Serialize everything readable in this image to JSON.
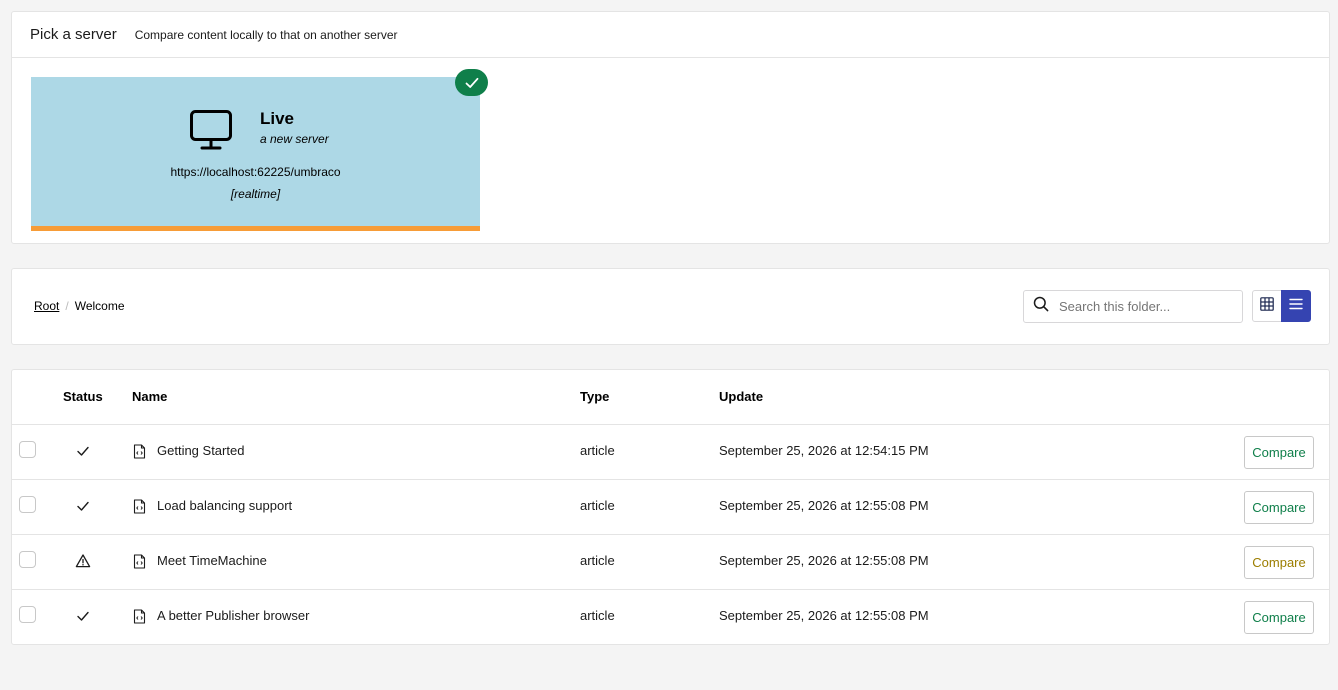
{
  "server_picker": {
    "title": "Pick a server",
    "subtitle": "Compare content locally to that on another server",
    "server": {
      "name": "Live",
      "description": "a new server",
      "url": "https://localhost:62225/umbraco",
      "mode": "[realtime]",
      "selected": true,
      "icon": "monitor-icon",
      "card_color": "#add8e6",
      "accent_color": "#f79c37"
    }
  },
  "breadcrumb": {
    "root_label": "Root",
    "separator": "/",
    "current_label": "Welcome"
  },
  "search": {
    "placeholder": "Search this folder...",
    "value": ""
  },
  "view_toggle": {
    "options": [
      "grid",
      "list"
    ],
    "selected": "list"
  },
  "table": {
    "headers": {
      "status": "Status",
      "name": "Name",
      "type": "Type",
      "update": "Update"
    },
    "rows": [
      {
        "status": "ok",
        "name": "Getting Started",
        "type": "article",
        "update": "September 25, 2026 at 12:54:15 PM",
        "action": "Compare"
      },
      {
        "status": "ok",
        "name": "Load balancing support",
        "type": "article",
        "update": "September 25, 2026 at 12:55:08 PM",
        "action": "Compare"
      },
      {
        "status": "warning",
        "name": "Meet TimeMachine",
        "type": "article",
        "update": "September 25, 2026 at 12:55:08 PM",
        "action": "Compare"
      },
      {
        "status": "ok",
        "name": "A better Publisher browser",
        "type": "article",
        "update": "September 25, 2026 at 12:55:08 PM",
        "action": "Compare"
      }
    ]
  }
}
